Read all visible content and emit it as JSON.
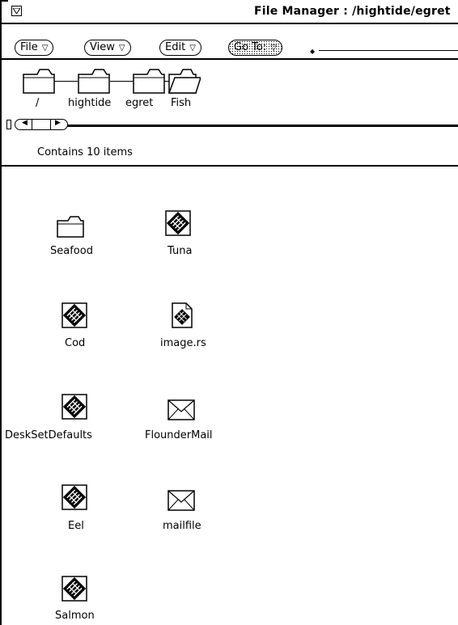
{
  "window": {
    "title": "File Manager : /hightide/egret"
  },
  "menubar": {
    "file": "File",
    "view": "View",
    "edit": "Edit",
    "goto": "Go To:"
  },
  "path": {
    "segments": [
      "/",
      "hightide",
      "egret",
      "Fish"
    ]
  },
  "status": {
    "text": "Contains 10 items"
  },
  "files": [
    {
      "name": "Seafood",
      "type": "folder-icon"
    },
    {
      "name": "Tuna",
      "type": "document-icon"
    },
    {
      "name": "Cod",
      "type": "document-icon"
    },
    {
      "name": "image.rs",
      "type": "image-file-icon"
    },
    {
      "name": "DeskSetDefaults",
      "type": "document-icon"
    },
    {
      "name": "FlounderMail",
      "type": "mail-icon"
    },
    {
      "name": "Eel",
      "type": "document-icon"
    },
    {
      "name": "mailfile",
      "type": "mail-icon"
    },
    {
      "name": "Salmon",
      "type": "document-icon"
    }
  ]
}
